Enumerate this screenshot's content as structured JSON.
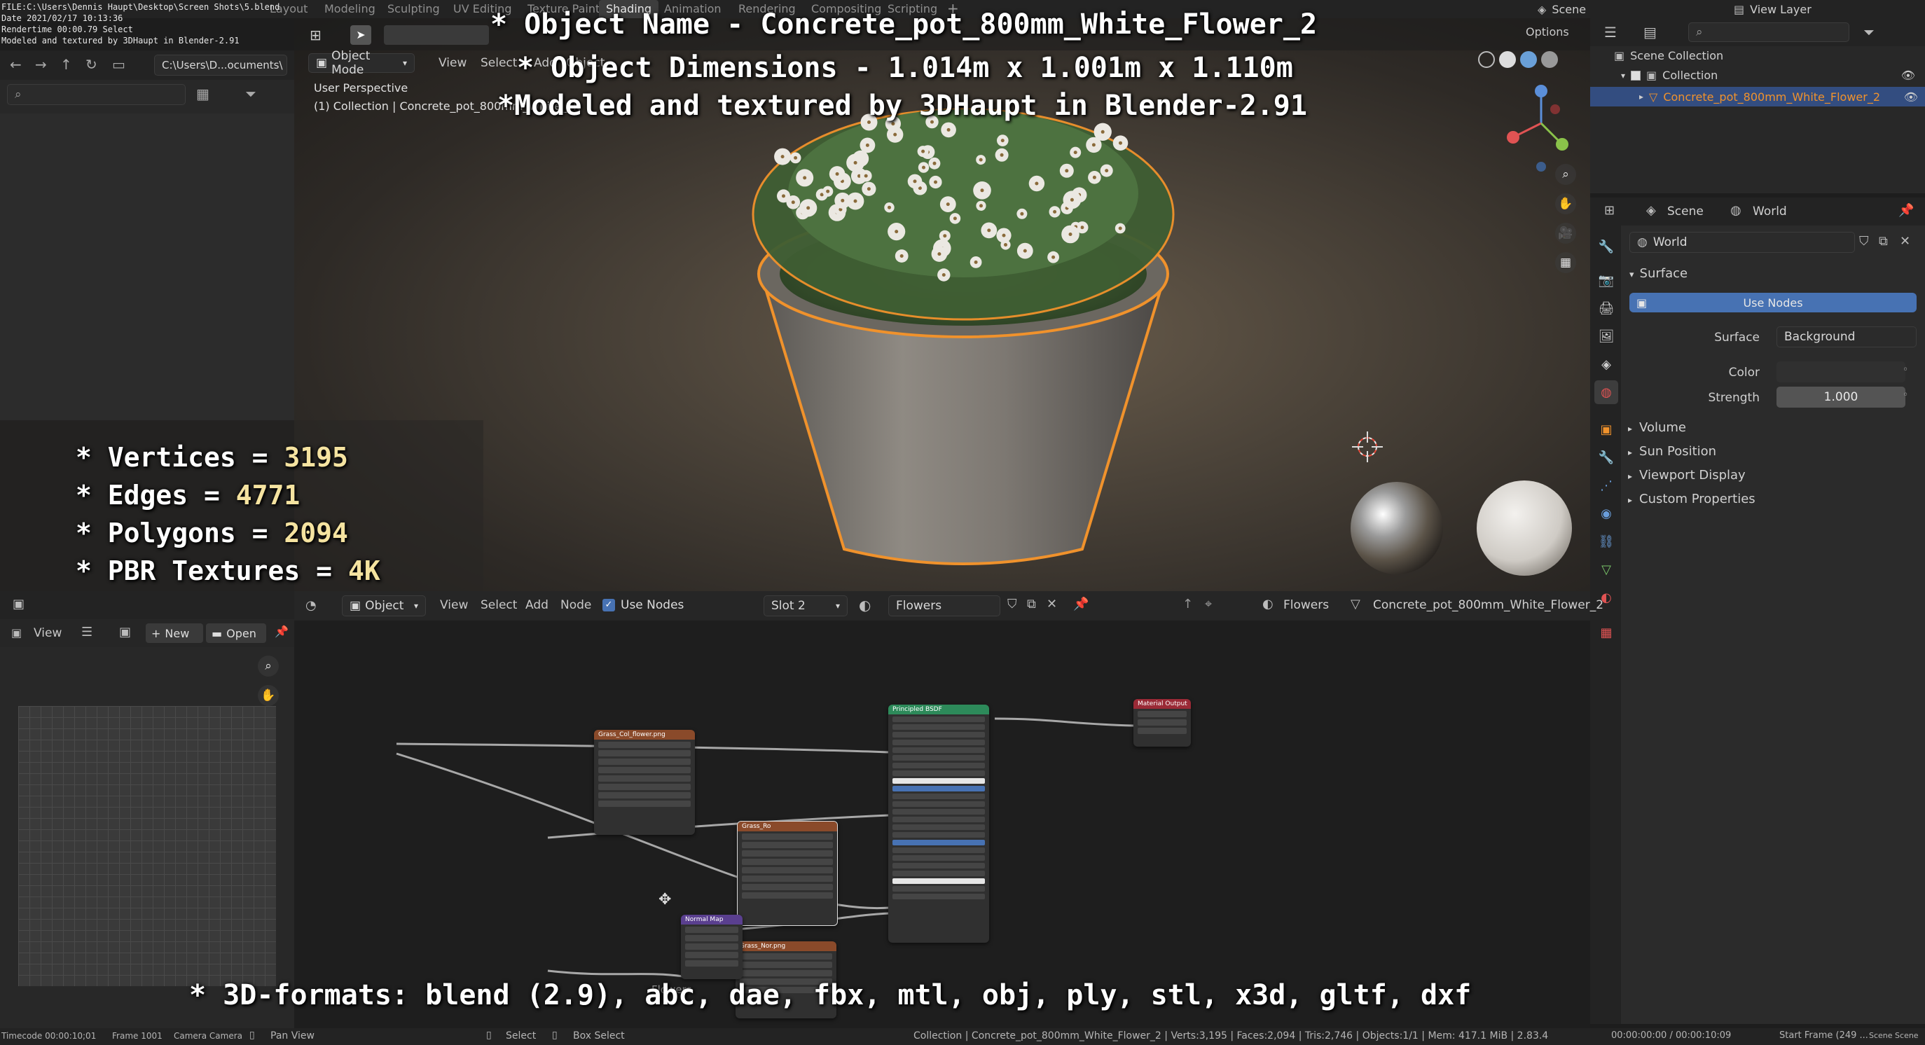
{
  "window": {
    "file_path": "FILE:C:\\Users\\Dennis Haupt\\Desktop\\Screen Shots\\5.blend",
    "date_line": "Date 2021/02/17 10:13:36",
    "render_time": "Rendertime 00:00.79 Select",
    "credit_line": "Modeled and textured by 3DHaupt in Blender-2.91"
  },
  "workspaces": [
    "Layout",
    "Modeling",
    "Sculpting",
    "UV Editing",
    "Texture Paint",
    "Shading",
    "Animation",
    "Rendering",
    "Compositing",
    "Scripting"
  ],
  "active_workspace": "Shading",
  "top_right": {
    "scene": "Scene",
    "view_layer": "View Layer"
  },
  "file_browser": {
    "path": "C:\\Users\\D...ocuments\\"
  },
  "viewport": {
    "mode": "Object Mode",
    "menus": [
      "View",
      "Select",
      "Add",
      "Object"
    ],
    "options": "Options",
    "perspective": "User Perspective",
    "collection_line": "(1) Collection | Concrete_pot_800mm_White_Flower_2",
    "selection_color": "#f0922c"
  },
  "overlay": {
    "object_name": "* Object Name - Concrete_pot_800mm_White_Flower_2",
    "dimensions": "* Object Dimensions -  1.014m x 1.001m x 1.110m",
    "modeled_by": "*Modeled and textured by 3DHaupt in Blender-2.91",
    "stats": [
      {
        "label": "* Vertices = ",
        "value": "3195"
      },
      {
        "label": "* Edges = ",
        "value": "4771"
      },
      {
        "label": "* Polygons = ",
        "value": "2094"
      },
      {
        "label": "* PBR Textures = ",
        "value": "4K"
      }
    ],
    "formats": "* 3D-formats: blend (2.9), abc, dae, fbx, mtl, obj, ply, stl, x3d, gltf, dxf"
  },
  "outliner": {
    "root": "Scene Collection",
    "collection": "Collection",
    "object": "Concrete_pot_800mm_White_Flower_2"
  },
  "properties": {
    "breadcrumb_scene": "Scene",
    "breadcrumb_world": "World",
    "world_name": "World",
    "surface_header": "Surface",
    "use_nodes": "Use Nodes",
    "surface_label": "Surface",
    "surface_value": "Background",
    "color_label": "Color",
    "strength_label": "Strength",
    "strength_value": "1.000",
    "collapsed_panels": [
      "Volume",
      "Sun Position",
      "Viewport Display",
      "Custom Properties"
    ]
  },
  "image_editor": {
    "view": "View",
    "new": "New",
    "open": "Open"
  },
  "node_editor": {
    "object": "Object",
    "menus": [
      "View",
      "Select",
      "Add",
      "Node"
    ],
    "use_nodes": "Use Nodes",
    "slot": "Slot 2",
    "material": "Flowers",
    "material_crumb": "Flowers",
    "object_crumb": "Concrete_pot_800mm_White_Flower_2",
    "frame_label": "Flowers",
    "nodes": {
      "bsdf": "Principled BSDF",
      "output": "Material Output",
      "normal": "Normal Map",
      "tex1": "Grass_Col_flower.png",
      "tex2": "Grass_Ro",
      "tex3": "Grass_Nor.png"
    }
  },
  "statusbar": {
    "timecode": "Timecode 00:00:10;01",
    "frame": "Frame 1001",
    "camera": "Camera Camera",
    "pan_view": "Pan View",
    "select": "Select",
    "box_select": "Box Select",
    "info": "Collection | Concrete_pot_800mm_White_Flower_2 | Verts:3,195 | Faces:2,094 | Tris:2,746 | Objects:1/1 | Mem: 417.1 MiB | 2.83.4",
    "time": "00:00:00:00 / 00:00:10:09",
    "start_frame": "Start Frame (249 ...",
    "scene_end": "Scene Scene"
  }
}
